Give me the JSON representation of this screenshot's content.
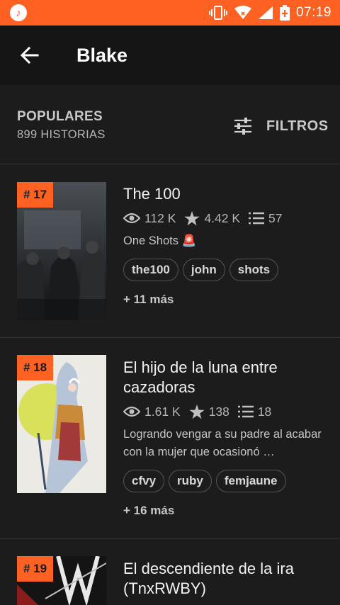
{
  "status_bar": {
    "time": "07:19",
    "app_icon": "music-note-icon"
  },
  "header": {
    "title": "Blake",
    "back_icon": "back-arrow-icon"
  },
  "sort": {
    "label": "POPULARES",
    "count": "899 HISTORIAS",
    "filters_label": "FILTROS"
  },
  "stories": [
    {
      "rank": "# 17",
      "title": "The 100",
      "reads": "112 K",
      "votes": "4.42 K",
      "parts": "57",
      "description": "One Shots 🚨",
      "tags": [
        "the100",
        "john",
        "shots"
      ],
      "more": "+ 11 más"
    },
    {
      "rank": "# 18",
      "title": "El hijo de la luna entre cazadoras",
      "reads": "1.61 K",
      "votes": "138",
      "parts": "18",
      "description": "Logrando vengar a su padre al acabar con la mujer que ocasionó …",
      "tags": [
        "cfvy",
        "ruby",
        "femjaune"
      ],
      "more": "+ 16 más"
    },
    {
      "rank": "# 19",
      "title": "El descendiente de la ira (TnxRWBY)"
    }
  ],
  "colors": {
    "accent": "#ff6122",
    "background": "#1c1c1c",
    "appbar": "#151515"
  }
}
